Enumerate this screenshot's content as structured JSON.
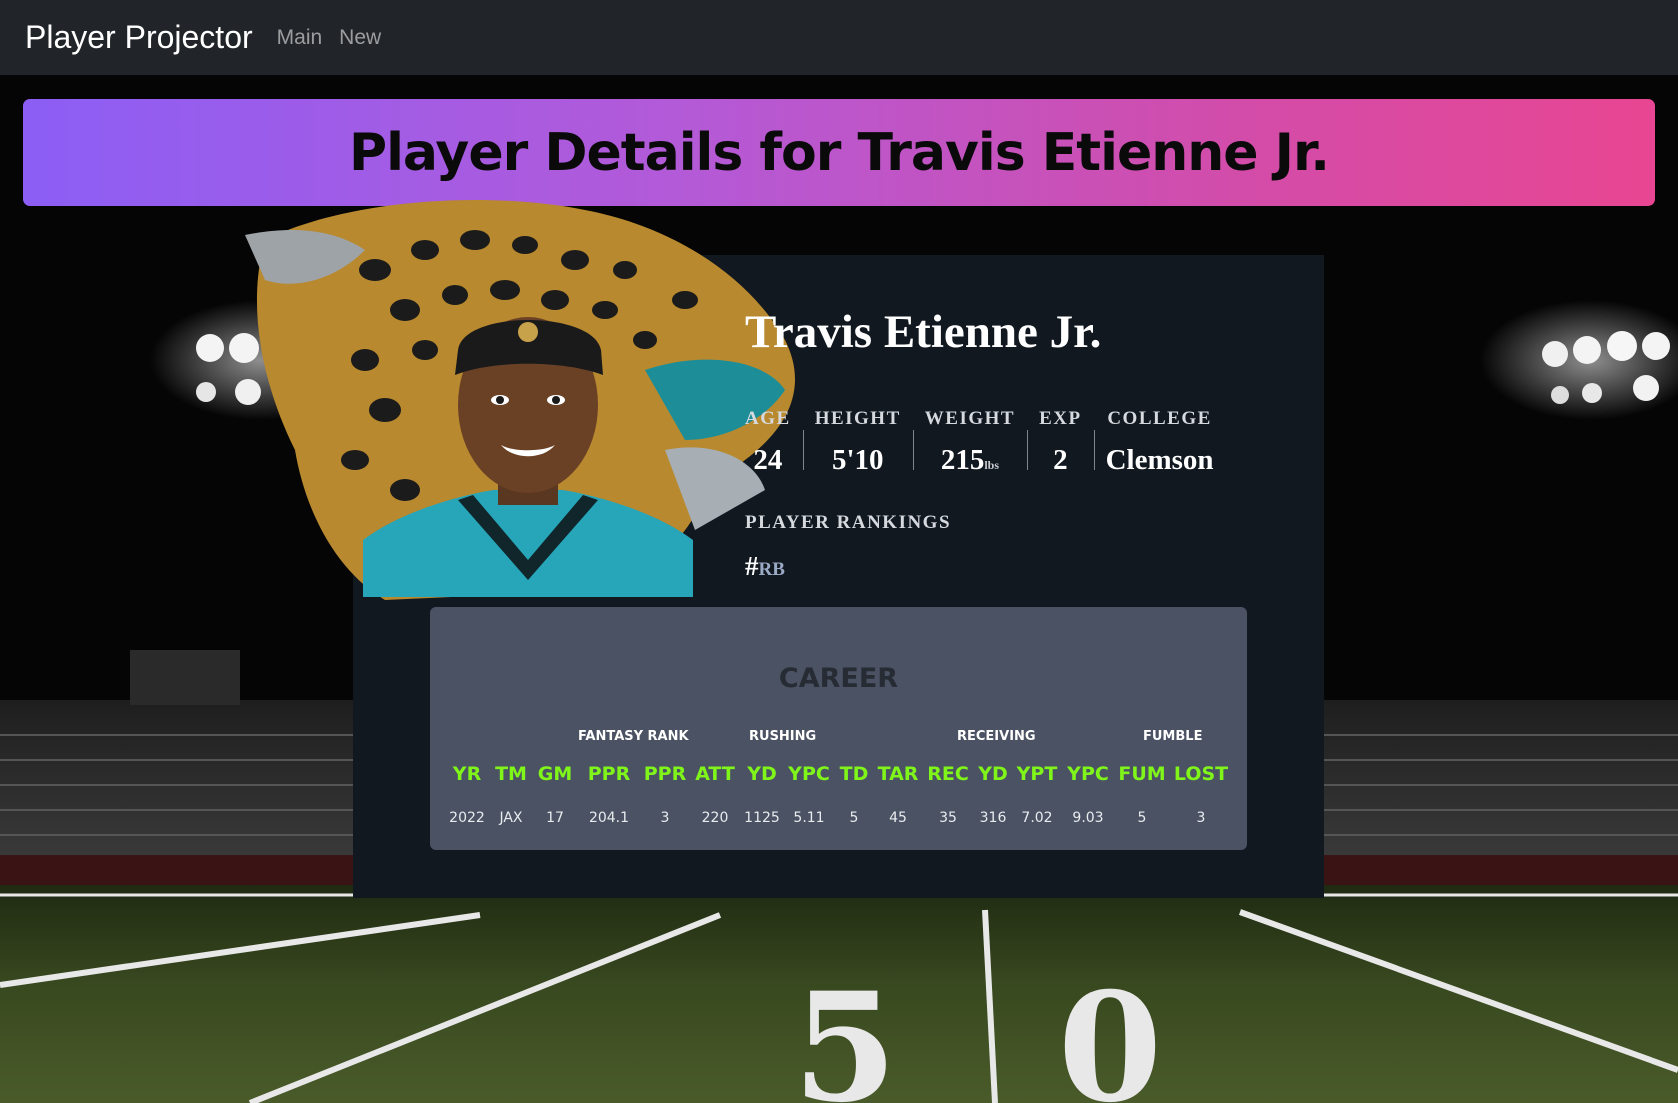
{
  "navbar": {
    "brand": "Player Projector",
    "links": [
      "Main",
      "New"
    ]
  },
  "banner": {
    "title": "Player Details for Travis Etienne Jr."
  },
  "player": {
    "name": "Travis Etienne Jr.",
    "stats": [
      {
        "label": "AGE",
        "value": "24",
        "unit": ""
      },
      {
        "label": "HEIGHT",
        "value": "5'10",
        "unit": ""
      },
      {
        "label": "WEIGHT",
        "value": "215",
        "unit": "lbs"
      },
      {
        "label": "EXP",
        "value": "2",
        "unit": ""
      },
      {
        "label": "COLLEGE",
        "value": "Clemson",
        "unit": ""
      }
    ],
    "rankings_label": "PLAYER RANKINGS",
    "ranking": {
      "hash": "#",
      "position": "RB"
    }
  },
  "career": {
    "title": "CAREER",
    "groups": [
      "FANTASY RANK",
      "RUSHING",
      "RECEIVING",
      "FUMBLE"
    ],
    "columns": [
      "YR",
      "TM",
      "GM",
      "PPR",
      "PPR",
      "ATT",
      "YD",
      "YPC",
      "TD",
      "TAR",
      "REC",
      "YD",
      "YPT",
      "YPC",
      "FUM",
      "LOST"
    ],
    "rows": [
      [
        "2022",
        "JAX",
        "17",
        "204.1",
        "3",
        "220",
        "1125",
        "5.11",
        "5",
        "45",
        "35",
        "316",
        "7.02",
        "9.03",
        "5",
        "3"
      ]
    ]
  },
  "colors": {
    "navbar": "#212529",
    "banner_start": "#8c5ef5",
    "banner_end": "#e84692",
    "card": "#111820",
    "career_panel": "#4a5263",
    "stat_header": "#7ff519"
  },
  "icons": {
    "team_logo": "jaguar-head-logo",
    "helmet_logo": "jaguars-logo"
  }
}
